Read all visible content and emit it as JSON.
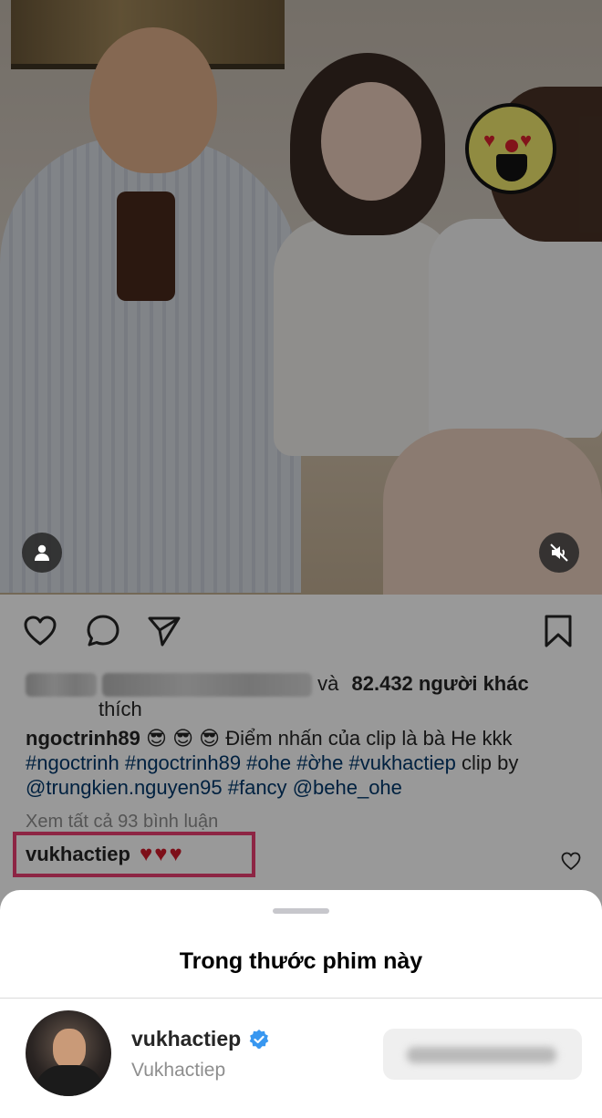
{
  "media": {
    "user_tag_icon": "person-icon",
    "mute_icon": "speaker-muted-icon",
    "emoji_sticker": "heart-eyes-emoji"
  },
  "actions": {
    "like_icon": "heart-icon",
    "comment_icon": "comment-bubble-icon",
    "share_icon": "paper-plane-icon",
    "save_icon": "bookmark-icon"
  },
  "likes": {
    "and_text": "và",
    "count_text": "82.432 người khác",
    "suffix": "thích"
  },
  "caption": {
    "username": "ngoctrinh89",
    "emojis": "😎 😎 😎",
    "text": "Điểm nhấn của clip là bà He kkk",
    "tags_line": "#ngoctrinh #ngoctrinh89 #ohe #ờhe #vukhactiep",
    "clip_by": "clip by",
    "mention1": "@trungkien.nguyen95",
    "tag_fancy": "#fancy",
    "mention2": "@behe_ohe"
  },
  "comments": {
    "view_all": "Xem tất cả 93 bình luận",
    "top_comment": {
      "username": "vukhactiep",
      "text": "♥♥♥"
    }
  },
  "sheet": {
    "title": "Trong thước phim này",
    "account": {
      "username": "vukhactiep",
      "full_name": "Vukhactiep",
      "verified": true
    }
  },
  "colors": {
    "highlight_border": "#ec3f72",
    "link": "#00376b",
    "verified_blue": "#3897f0"
  }
}
